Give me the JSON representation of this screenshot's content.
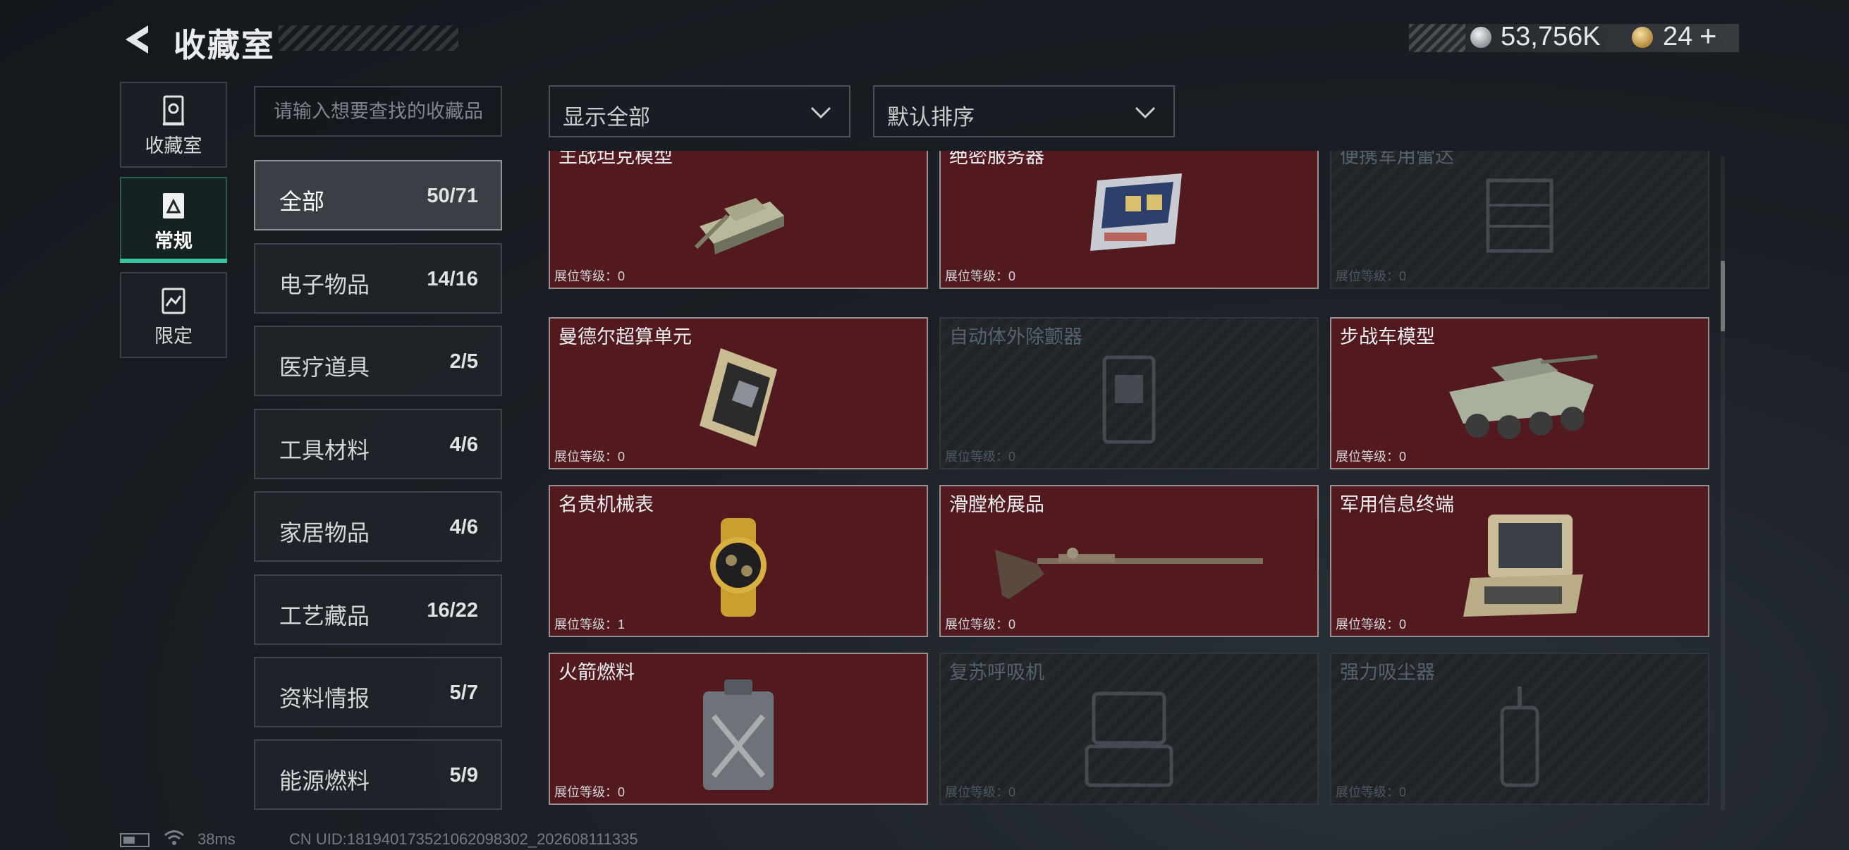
{
  "header": {
    "title": "收藏室",
    "silver_amount": "53,756K",
    "gold_amount": "24",
    "add_label": "+"
  },
  "nav": [
    {
      "label": "收藏室",
      "icon": "vault-icon"
    },
    {
      "label": "常规",
      "icon": "collection-icon",
      "active": true
    },
    {
      "label": "限定",
      "icon": "limited-icon"
    }
  ],
  "search": {
    "placeholder": "请输入想要查找的收藏品"
  },
  "filters": {
    "display": "显示全部",
    "sort": "默认排序"
  },
  "categories": [
    {
      "name": "全部",
      "count": "50/71",
      "active": true
    },
    {
      "name": "电子物品",
      "count": "14/16"
    },
    {
      "name": "医疗道具",
      "count": "2/5"
    },
    {
      "name": "工具材料",
      "count": "4/6"
    },
    {
      "name": "家居物品",
      "count": "4/6"
    },
    {
      "name": "工艺藏品",
      "count": "16/22"
    },
    {
      "name": "资料情报",
      "count": "5/7"
    },
    {
      "name": "能源燃料",
      "count": "5/9"
    }
  ],
  "level_label": "展位等级：",
  "items": [
    {
      "name": "主战坦克模型",
      "level": "0",
      "owned": true,
      "icon": "tank-model-icon"
    },
    {
      "name": "绝密服务器",
      "level": "0",
      "owned": true,
      "icon": "server-icon"
    },
    {
      "name": "便携军用雷达",
      "level": "0",
      "owned": false,
      "icon": "radar-icon"
    },
    {
      "name": "曼德尔超算单元",
      "level": "0",
      "owned": true,
      "icon": "compute-unit-icon"
    },
    {
      "name": "自动体外除颤器",
      "level": "0",
      "owned": false,
      "icon": "defibrillator-icon"
    },
    {
      "name": "步战车模型",
      "level": "0",
      "owned": true,
      "icon": "ifv-model-icon"
    },
    {
      "name": "名贵机械表",
      "level": "1",
      "owned": true,
      "icon": "watch-icon"
    },
    {
      "name": "滑膛枪展品",
      "level": "0",
      "owned": true,
      "icon": "musket-icon"
    },
    {
      "name": "军用信息终端",
      "level": "0",
      "owned": true,
      "icon": "terminal-icon"
    },
    {
      "name": "火箭燃料",
      "level": "0",
      "owned": true,
      "icon": "fuel-can-icon"
    },
    {
      "name": "复苏呼吸机",
      "level": "0",
      "owned": false,
      "icon": "ventilator-icon"
    },
    {
      "name": "强力吸尘器",
      "level": "0",
      "owned": false,
      "icon": "vacuum-icon"
    }
  ],
  "status_bar": {
    "ping": "38ms",
    "uid": "CN UID:18194017352106209830​2_202608111335"
  }
}
